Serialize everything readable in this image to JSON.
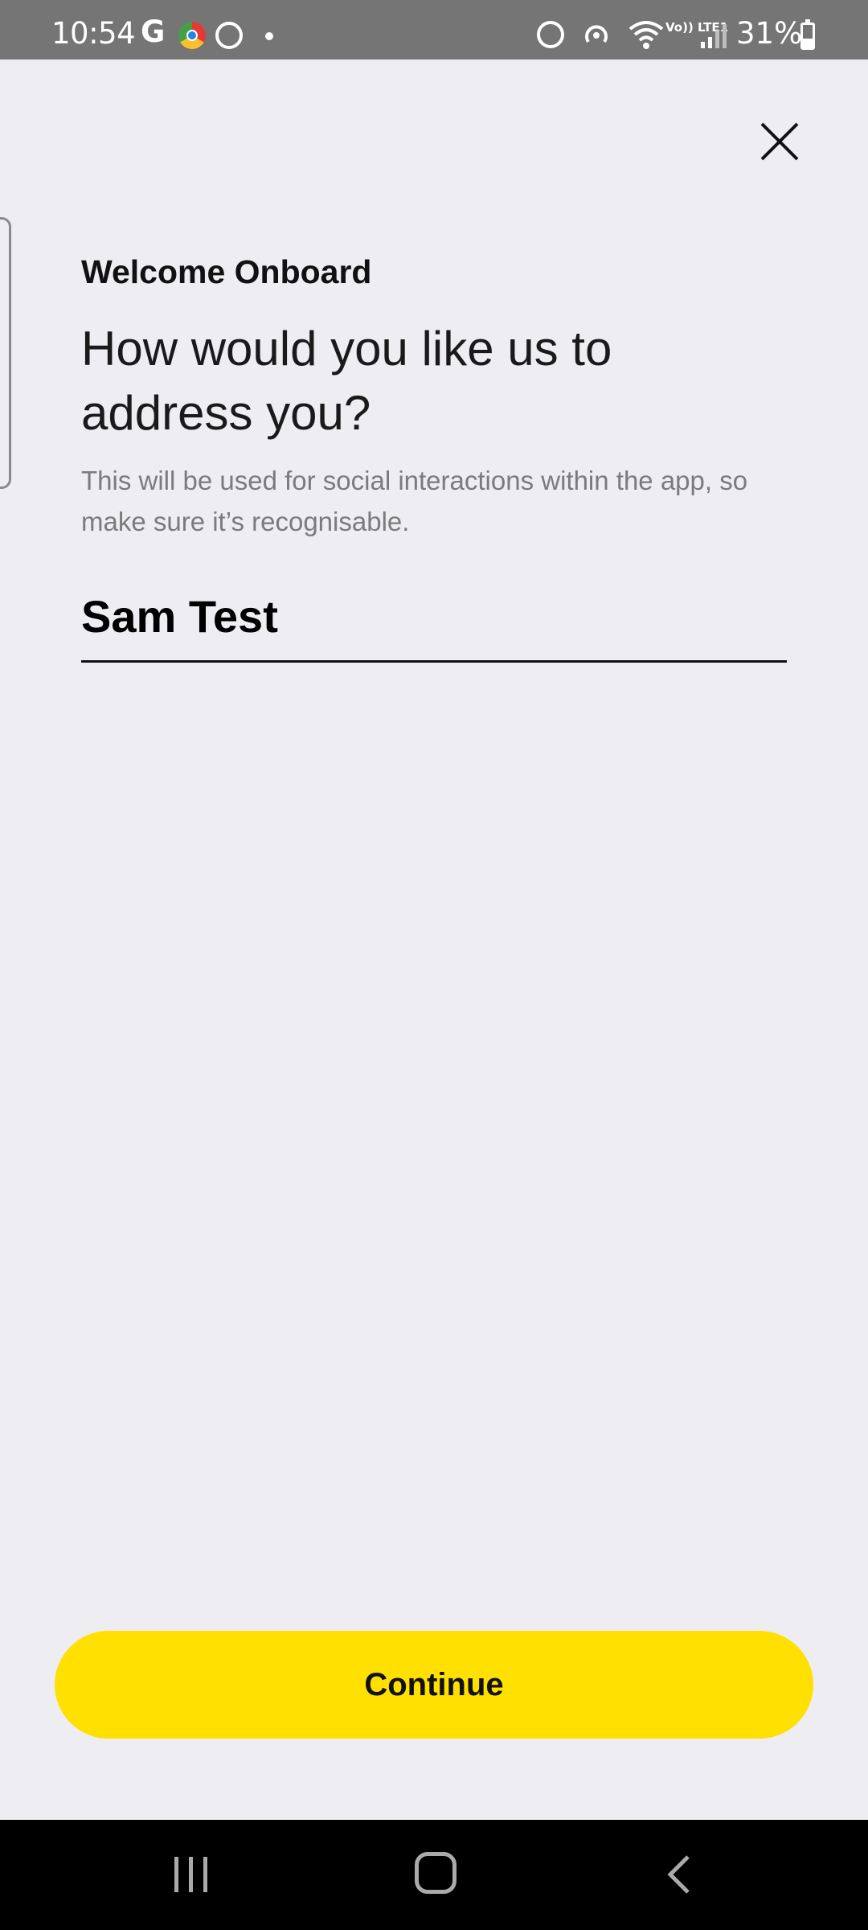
{
  "status_bar": {
    "time": "10:54",
    "google_glyph": "G",
    "network_label": "Vo)) LTE1",
    "battery_percent": "31%"
  },
  "icons": {
    "close": "close-icon",
    "recent_apps": "recent-apps-icon",
    "home": "home-icon",
    "back": "back-icon"
  },
  "onboarding": {
    "eyebrow": "Welcome Onboard",
    "heading": "How would you like us to address you?",
    "helper": "This will be used for social interactions within the app, so make sure it’s recognisable.",
    "name_value": "Sam Test"
  },
  "actions": {
    "continue_label": "Continue"
  },
  "colors": {
    "background": "#eeedf2",
    "accent": "#ffe000",
    "status_bar": "#757575",
    "nav_bar": "#000000"
  }
}
